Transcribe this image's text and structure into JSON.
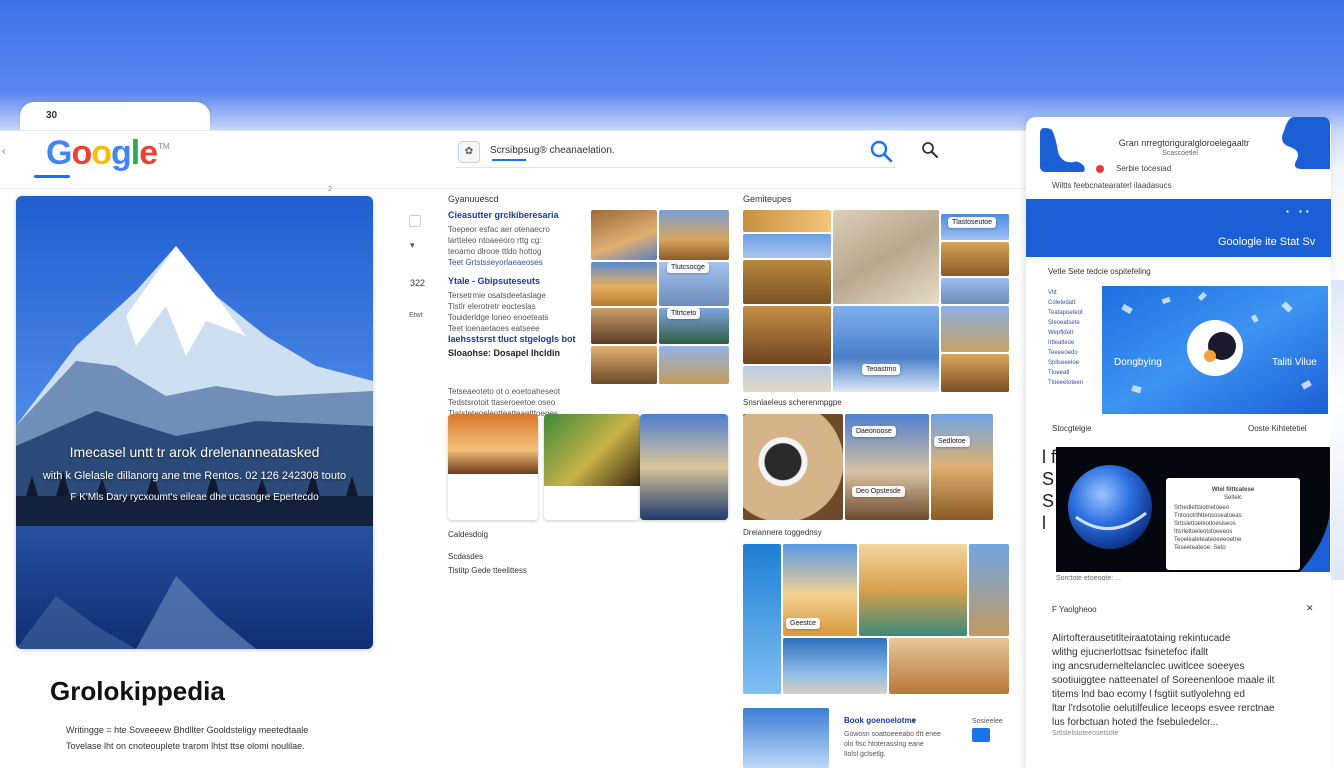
{
  "tab": {
    "number": "30"
  },
  "logo": {
    "text": "Google",
    "tm": "TM"
  },
  "search": {
    "favicon_glyph": "✿",
    "query": "Scrsibpsug® cheanaelation."
  },
  "ruler_number": "2",
  "hero": {
    "headline": "Imecasel untt tr arok drelenanneatasked",
    "line2": "with k Glelasle dillanorg ane tme Rentos. 02 126 242308 touto",
    "line3": "F K'Mls Dary rycxoumt's eileae dhe ucasogre Epertecdo"
  },
  "site": {
    "title": "Grolokippedia",
    "desc_line1": "Writingge = hte Soveeeew Bhdllter Gooldsteligy meetedtaale",
    "desc_line2": "Tovelase lht on cnoteouplete trarom lhtst ttse olomi noulilae."
  },
  "side_column": {
    "arrow": "▾",
    "number": "322",
    "small": "Etwt"
  },
  "results": {
    "col_title": "Gyanuuescd",
    "blocks": [
      {
        "heading": "Cieasutter grclkiberesaria",
        "lines": [
          "Toepeor esfac aer otenaecro",
          "lartteleo ntoaeeoro rttg cg:",
          "teoarno dlrooe ttldo hottog",
          "Teet Grtstsseyorlaeaeoses"
        ]
      },
      {
        "heading": "Ytale - Gbipsuteseuts",
        "lines": [
          "Tersetrmie osatsdeetaslage",
          "Tlstlr elerotretr eocteslas",
          "Touiderldge loneo enoeteats",
          "Teet loenaetaoes eatseee"
        ]
      },
      {
        "heading": "Iaehsstsrst tluct stgelogls bot",
        "lines": [
          "Sloaohse: Dosapel Ihcldin"
        ]
      },
      {
        "heading": "",
        "lines": [
          "Tetseaeoteto ot o eoetoaheseot",
          "Tedstsrotoit ttaseroeetoe oseo",
          "Tlatsteteoeleotteatteaetttoeoes"
        ]
      }
    ],
    "lower_labels": [
      "Caldesdoig",
      "Scdasdes",
      "Tistitp Gede tteelittess"
    ]
  },
  "grid_a": {
    "chip1": "Tlutcsocge",
    "chip2": "Tltrtceto"
  },
  "grid_b": {
    "title": "Gemiteupes",
    "chip1": "Tlastoseutoe",
    "chip2": "Teoastmo"
  },
  "section_c": {
    "title": "Snsnlaeleus scherenmpgpe",
    "chip1": "Daeonoose",
    "chip2": "Sedlotoe",
    "chip3": "Deo Opstesde"
  },
  "section_d": {
    "title": "Dreiannere toggednsy",
    "chip1": "Geestce"
  },
  "bottom_card": {
    "heading": "Book goenoelotme",
    "lines": [
      "Gowosn soattoeeeabo tltt enee",
      "olo ftsc htoterasslng eane",
      "Ilolsl gclsetlg."
    ],
    "label_right": "Sosieelee"
  },
  "rpanel": {
    "title": "Gran nrregtoriguralgloroelegaaltr",
    "sub": "Scascoetlel",
    "sub2": "Serbie tocesiad",
    "meta": "Wiltts feebcnatearaterl ilaadasucs",
    "banner_text": "Goologle ite Stat Sv",
    "banner_icons": "▪ ▪▪",
    "section1": "Vetle Sete tedcie ospitefeling",
    "list": [
      "Vltt",
      "Coletedatt",
      "Teatapoeteot",
      "Sleoeatsete",
      "Wepfldetl",
      "Irtlealteoe",
      "Teeeeoedo",
      "Spllseeeloe",
      "Tloeeatl",
      "Tloeeetoteen"
    ],
    "feature_left": "Dongbying",
    "feature_right": "Taliti Vilue",
    "section2_left": "Stocgtelgie",
    "section2_right": "Ooste Kihtetetiel",
    "left_chars": "l f S S l",
    "video_popup": [
      "Wtel filttcatese",
      "Seltelc",
      "Srhedlettsiotnetoeeo",
      "Tntoootrlhttensoseatoeas",
      "Srttslettoeleotloesiseos",
      "Itlsrlettoeleotstoeeeos",
      "Teoelealeteateoeeeoetne",
      "Teseeteateoe: Seto"
    ],
    "video_hint": "Sorctote etoeoote: ...",
    "article_header": "F Yaolgheoo",
    "article_lines": [
      "Alirtofterausetitlteiraatotaing rekintucade",
      "wlithg ejucnerlottsac fsinetefoc ifallt",
      "ing ancsruderneltelanclec uwitlcee soeeyes",
      "sootiuiggtee natteenatel of Soreenenlooe maale ilt",
      "titems lnd bao ecomy l fsgtiit sutlyolehng ed",
      "ltar l'rdsotolie oelutilfeulice leceops esvee rerctnae",
      "lus forbctuan hoted the fsebuledelcr..."
    ],
    "article_meta": "Srtlslelstoteeosetsote"
  }
}
